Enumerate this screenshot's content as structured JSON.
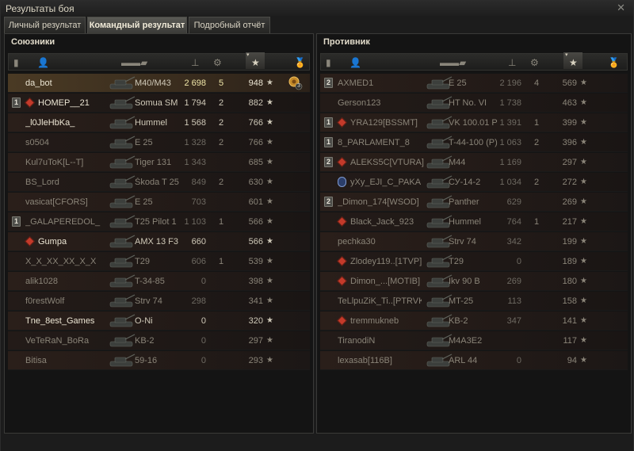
{
  "window": {
    "title": "Результаты боя"
  },
  "tabs": [
    {
      "label": "Личный результат",
      "active": false
    },
    {
      "label": "Командный результат",
      "active": true
    },
    {
      "label": "Подробный отчёт",
      "active": false
    }
  ],
  "allies": {
    "title": "Союзники",
    "rows": [
      {
        "platoon": "",
        "clan": false,
        "name": "da_bot",
        "tank": "M40/M43",
        "damage": "2 698",
        "kills": "5",
        "xp": "948",
        "me": true,
        "dead": false,
        "medal": true
      },
      {
        "platoon": "1",
        "clan": true,
        "name": "HOMEP__21",
        "tank": "Somua SM",
        "damage": "1 794",
        "kills": "2",
        "xp": "882",
        "me": false,
        "dead": false,
        "medal": false
      },
      {
        "platoon": "",
        "clan": false,
        "name": "_l0JleHbKa_",
        "tank": "Hummel",
        "damage": "1 568",
        "kills": "2",
        "xp": "766",
        "me": false,
        "dead": false,
        "medal": false
      },
      {
        "platoon": "",
        "clan": false,
        "name": "s0504",
        "tank": "E 25",
        "damage": "1 328",
        "kills": "2",
        "xp": "766",
        "me": false,
        "dead": true,
        "medal": false
      },
      {
        "platoon": "",
        "clan": false,
        "name": "Kul7uToK[L--T]",
        "tank": "Tiger 131",
        "damage": "1 343",
        "kills": "",
        "xp": "685",
        "me": false,
        "dead": true,
        "medal": false
      },
      {
        "platoon": "",
        "clan": false,
        "name": "BS_Lord",
        "tank": "Škoda T 25",
        "damage": "849",
        "kills": "2",
        "xp": "630",
        "me": false,
        "dead": true,
        "medal": false
      },
      {
        "platoon": "",
        "clan": false,
        "name": "vasicat[CFORS]",
        "tank": "E 25",
        "damage": "703",
        "kills": "",
        "xp": "601",
        "me": false,
        "dead": true,
        "medal": false
      },
      {
        "platoon": "1",
        "clan": false,
        "name": "_GALAPEREDOL_",
        "tank": "T25 Pilot 1",
        "damage": "1 103",
        "kills": "1",
        "xp": "566",
        "me": false,
        "dead": true,
        "medal": false
      },
      {
        "platoon": "",
        "clan": true,
        "name": "Gumpa",
        "tank": "AMX 13 F3",
        "damage": "660",
        "kills": "",
        "xp": "566",
        "me": false,
        "dead": false,
        "medal": false
      },
      {
        "platoon": "",
        "clan": false,
        "name": "X_X_XX_XX_X_X",
        "tank": "T29",
        "damage": "606",
        "kills": "1",
        "xp": "539",
        "me": false,
        "dead": true,
        "medal": false
      },
      {
        "platoon": "",
        "clan": false,
        "name": "alik1028",
        "tank": "T-34-85",
        "damage": "0",
        "kills": "",
        "xp": "398",
        "me": false,
        "dead": true,
        "medal": false
      },
      {
        "platoon": "",
        "clan": false,
        "name": "f0restWolf",
        "tank": "Strv 74",
        "damage": "298",
        "kills": "",
        "xp": "341",
        "me": false,
        "dead": true,
        "medal": false
      },
      {
        "platoon": "",
        "clan": false,
        "name": "Tne_8est_Games",
        "tank": "O-Ni",
        "damage": "0",
        "kills": "",
        "xp": "320",
        "me": false,
        "dead": false,
        "medal": false
      },
      {
        "platoon": "",
        "clan": false,
        "name": "VeTeRaN_BoRa",
        "tank": "KB-2",
        "damage": "0",
        "kills": "",
        "xp": "297",
        "me": false,
        "dead": true,
        "medal": false
      },
      {
        "platoon": "",
        "clan": false,
        "name": "Bitisa",
        "tank": "59-16",
        "damage": "0",
        "kills": "",
        "xp": "293",
        "me": false,
        "dead": true,
        "medal": false
      }
    ]
  },
  "enemies": {
    "title": "Противник",
    "rows": [
      {
        "platoon": "2",
        "clan": false,
        "name": "AXMED1",
        "tank": "E 25",
        "damage": "2 196",
        "kills": "4",
        "xp": "569",
        "dead": true
      },
      {
        "platoon": "",
        "clan": false,
        "name": "Gerson123",
        "tank": "HT No. VI",
        "damage": "1 738",
        "kills": "",
        "xp": "463",
        "dead": true
      },
      {
        "platoon": "1",
        "clan": true,
        "name": "YRA129[BSSMT]",
        "tank": "VK 100.01 P",
        "damage": "1 391",
        "kills": "1",
        "xp": "399",
        "dead": true
      },
      {
        "platoon": "1",
        "clan": false,
        "name": "8_PARLAMENT_8",
        "tank": "T-44-100 (P)",
        "damage": "1 063",
        "kills": "2",
        "xp": "396",
        "dead": true
      },
      {
        "platoon": "2",
        "clan": true,
        "name": "ALEKS5C[VTURA]",
        "tank": "M44",
        "damage": "1 169",
        "kills": "",
        "xp": "297",
        "dead": true
      },
      {
        "platoon": "",
        "clan": false,
        "name": "yXy_EJI_C_PAKA",
        "tank": "СУ-14-2",
        "damage": "1 034",
        "kills": "2",
        "xp": "272",
        "dead": true,
        "special": true
      },
      {
        "platoon": "2",
        "clan": false,
        "name": "_Dimon_174[WSOD]",
        "tank": "Panther",
        "damage": "629",
        "kills": "",
        "xp": "269",
        "dead": true
      },
      {
        "platoon": "",
        "clan": true,
        "name": "Black_Jack_923",
        "tank": "Hummel",
        "damage": "764",
        "kills": "1",
        "xp": "217",
        "dead": true
      },
      {
        "platoon": "",
        "clan": false,
        "name": "pechka30",
        "tank": "Strv 74",
        "damage": "342",
        "kills": "",
        "xp": "199",
        "dead": true
      },
      {
        "platoon": "",
        "clan": true,
        "name": "Zlodey119..[1TVP]",
        "tank": "T29",
        "damage": "0",
        "kills": "",
        "xp": "189",
        "dead": true
      },
      {
        "platoon": "",
        "clan": true,
        "name": "Dimon_...[MOTIB]",
        "tank": "Ikv 90 B",
        "damage": "269",
        "kills": "",
        "xp": "180",
        "dead": true
      },
      {
        "platoon": "",
        "clan": false,
        "name": "TeLlpuZiK_Ti..[PTRVK]",
        "tank": "MT-25",
        "damage": "113",
        "kills": "",
        "xp": "158",
        "dead": true
      },
      {
        "platoon": "",
        "clan": true,
        "name": "tremmukneb",
        "tank": "KB-2",
        "damage": "347",
        "kills": "",
        "xp": "141",
        "dead": true
      },
      {
        "platoon": "",
        "clan": false,
        "name": "TiranodiN",
        "tank": "M4A3E2",
        "damage": "",
        "kills": "",
        "xp": "117",
        "dead": true
      },
      {
        "platoon": "",
        "clan": false,
        "name": "lexasab[116B]",
        "tank": "ARL 44",
        "damage": "0",
        "kills": "",
        "xp": "94",
        "dead": true
      }
    ]
  },
  "medal_label": "3",
  "icons": {
    "platoon": "platoon-icon",
    "player": "player-icon",
    "tank": "tank-icon",
    "damage": "damage-icon",
    "kills": "kills-icon",
    "xp": "star-icon",
    "medals": "medal-icon",
    "sort": "sort-arrow-icon"
  },
  "colors": {
    "accent": "#efe6a8",
    "clan": "#c43a2a"
  }
}
